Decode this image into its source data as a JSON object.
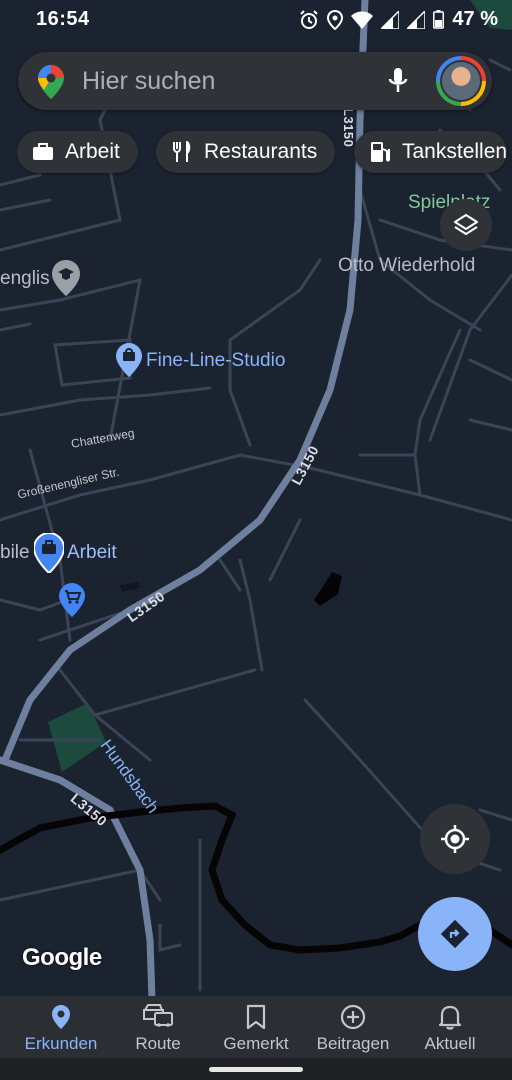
{
  "status_bar": {
    "time": "16:54",
    "battery_percent": "47 %",
    "icons": [
      "alarm-icon",
      "location-icon",
      "wifi-icon",
      "signal-icon",
      "signal-icon",
      "battery-icon"
    ]
  },
  "search": {
    "placeholder": "Hier suchen",
    "left_icon": "google-maps-pin-icon",
    "right_icons": [
      "microphone-icon",
      "avatar"
    ]
  },
  "chips": [
    {
      "label": "Arbeit",
      "icon": "briefcase-icon"
    },
    {
      "label": "Restaurants",
      "icon": "fork-knife-icon"
    },
    {
      "label": "Tankstellen",
      "icon": "gas-station-icon"
    }
  ],
  "map": {
    "labels": {
      "spielplatz": "Spielplatz",
      "otto": "Otto Wiederhold",
      "englis": "englis",
      "fine_line": "Fine-Line-Studio",
      "chattenweg": "Chattenweg",
      "grossenengliser": "Großenengliser Str.",
      "bile": "bile",
      "arbeit": "Arbeit",
      "l3150_a": "L3150",
      "l3150_b": "L3150",
      "l3150_c": "L3150",
      "l3150_top": "L3150",
      "hundsbach": "Hundsbach",
      "google": "Google"
    },
    "colors": {
      "background": "#1b2331",
      "road": "#3b4557",
      "main_road": "#6f7f9e",
      "river": "#050505",
      "poi": "#8ab4f8",
      "park": "#81c995",
      "accent": "#8ab4f8"
    }
  },
  "buttons": {
    "layers": "layers-icon",
    "my_location": "my-location-icon",
    "directions": "directions-icon"
  },
  "bottom_nav": [
    {
      "label": "Erkunden",
      "icon": "explore-pin-icon",
      "active": true
    },
    {
      "label": "Route",
      "icon": "car-icon",
      "active": false
    },
    {
      "label": "Gemerkt",
      "icon": "bookmark-icon",
      "active": false
    },
    {
      "label": "Beitragen",
      "icon": "add-circle-icon",
      "active": false
    },
    {
      "label": "Aktuell",
      "icon": "bell-icon",
      "active": false
    }
  ]
}
